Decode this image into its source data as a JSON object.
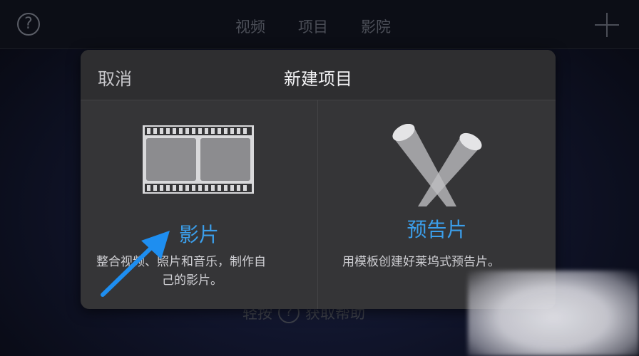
{
  "topbar": {
    "help_glyph": "?",
    "tabs": [
      {
        "label": "视频"
      },
      {
        "label": "项目"
      },
      {
        "label": "影院"
      }
    ]
  },
  "dialog": {
    "cancel_label": "取消",
    "title": "新建项目",
    "options": [
      {
        "title": "影片",
        "desc_line1": "整合视频、照片和音乐，制作自",
        "desc_line2": "己的影片。",
        "icon": "film-icon"
      },
      {
        "title": "预告片",
        "desc_line1": "用模板创建好莱坞式预告片。",
        "icon": "spotlight-icon"
      }
    ]
  },
  "bottom_help": {
    "prefix": "轻按",
    "glyph": "?",
    "suffix": "获取帮助"
  },
  "colors": {
    "accent": "#3b9eea",
    "dialog_bg": "#353537",
    "arrow": "#1e8ef0"
  }
}
